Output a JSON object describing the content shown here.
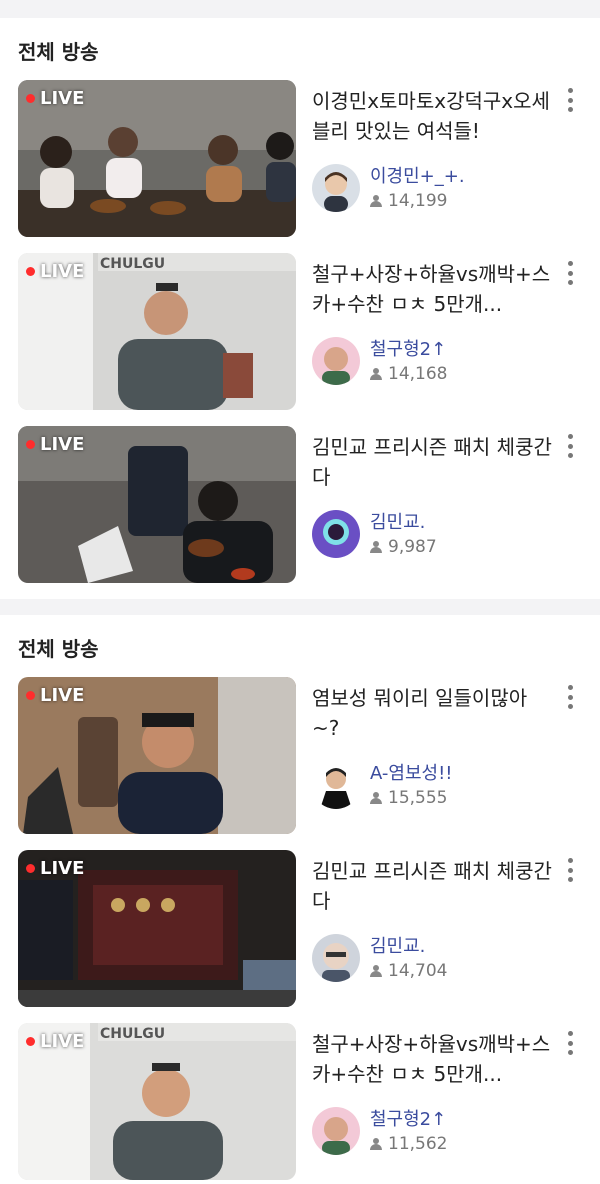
{
  "sections": [
    {
      "title": "전체 방송",
      "items": [
        {
          "live_label": "LIVE",
          "title": "이경민x토마토x강덕구x오세블리 맛있는 여석들!",
          "streamer": "이경민+_+.",
          "viewers": "14,199"
        },
        {
          "live_label": "LIVE",
          "title": "철구+사장+하율vs깨박+스카+수찬 ㅁㅊ 5만개...",
          "streamer": "철구형2↑",
          "viewers": "14,168"
        },
        {
          "live_label": "LIVE",
          "title": "김민교 프리시즌 패치 체쿵간다",
          "streamer": "김민교.",
          "viewers": "9,987"
        }
      ]
    },
    {
      "title": "전체 방송",
      "items": [
        {
          "live_label": "LIVE",
          "title": "염보성 뭐이리 일들이많아~?",
          "streamer": "A-염보성!!",
          "viewers": "15,555"
        },
        {
          "live_label": "LIVE",
          "title": "김민교 프리시즌 패치 체쿵간다",
          "streamer": "김민교.",
          "viewers": "14,704"
        },
        {
          "live_label": "LIVE",
          "title": "철구+사장+하율vs깨박+스카+수찬 ㅁㅊ 5만개...",
          "streamer": "철구형2↑",
          "viewers": "11,562"
        }
      ]
    }
  ],
  "icons": {
    "live": "live-dot-icon",
    "viewers": "person-icon",
    "more": "more-vertical-icon"
  },
  "colors": {
    "live_dot": "#ff2d2d",
    "streamer_name": "#3b4c9e",
    "meta": "#777777",
    "separator": "#f3f3f5"
  }
}
